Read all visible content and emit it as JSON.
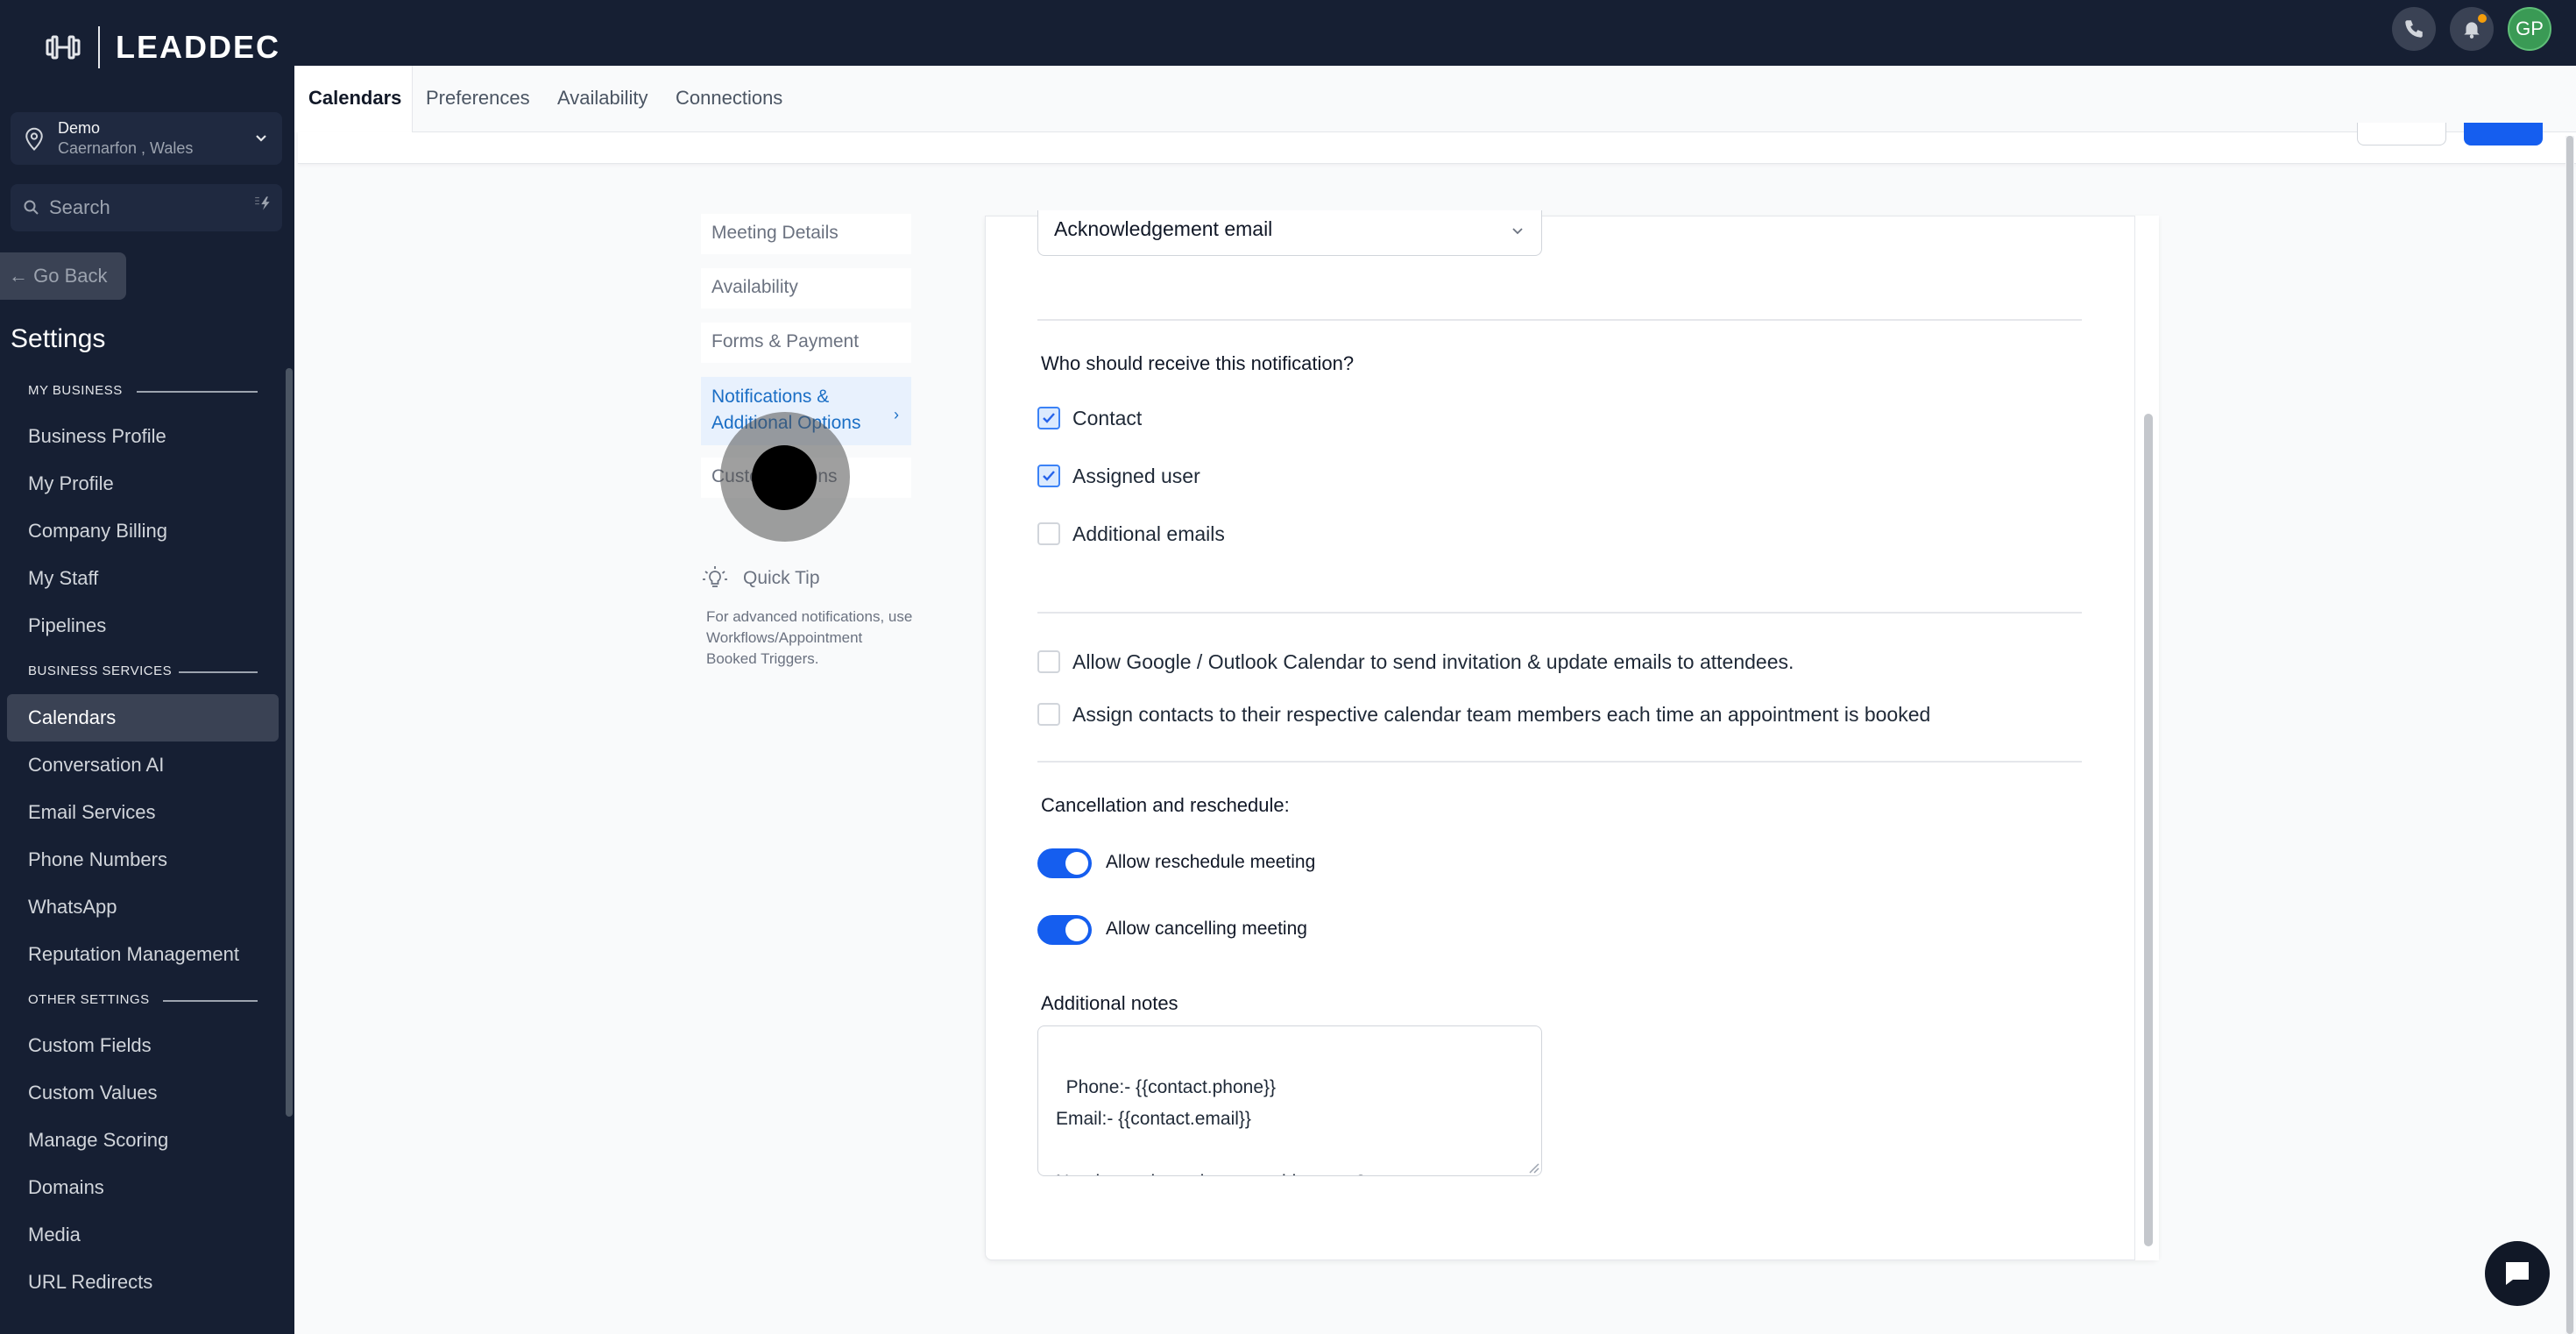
{
  "app": {
    "logo_text": "LEADDEC"
  },
  "location": {
    "name": "Demo",
    "sub": "Caernarfon , Wales"
  },
  "search": {
    "placeholder": "Search"
  },
  "sidebar": {
    "go_back": "Go Back",
    "settings_title": "Settings",
    "sections": {
      "my_business": "MY BUSINESS",
      "business_services": "BUSINESS SERVICES",
      "other_settings": "OTHER SETTINGS"
    },
    "items": [
      "Business Profile",
      "My Profile",
      "Company Billing",
      "My Staff",
      "Pipelines",
      "Calendars",
      "Conversation AI",
      "Email Services",
      "Phone Numbers",
      "WhatsApp",
      "Reputation Management",
      "Custom Fields",
      "Custom Values",
      "Manage Scoring",
      "Domains",
      "Media",
      "URL Redirects"
    ],
    "active_item": "Calendars"
  },
  "top": {
    "avatar_initials": "GP"
  },
  "tabs": [
    "Calendars",
    "Preferences",
    "Availability",
    "Connections"
  ],
  "steps": {
    "meeting_details": "Meeting Details",
    "availability": "Availability",
    "forms_payment": "Forms & Payment",
    "notifications_line1": "Notifications &",
    "notifications_line2": "Additional Options",
    "customizations": "Customizations"
  },
  "quick_tip": {
    "title": "Quick Tip",
    "text": "For advanced notifications, use Workflows/Appointment Booked Triggers."
  },
  "form": {
    "email_select": "Acknowledgement email",
    "recipients_label": "Who should receive this notification?",
    "recipients": [
      {
        "label": "Contact",
        "checked": true
      },
      {
        "label": "Assigned user",
        "checked": true
      },
      {
        "label": "Additional emails",
        "checked": false
      }
    ],
    "options": [
      {
        "label": "Allow Google / Outlook Calendar to send invitation & update emails to attendees.",
        "checked": false
      },
      {
        "label": "Assign contacts to their respective calendar team members each time an appointment is booked",
        "checked": false
      }
    ],
    "cancel_label": "Cancellation and reschedule:",
    "toggles": [
      {
        "label": "Allow reschedule meeting",
        "on": true
      },
      {
        "label": "Allow cancelling meeting",
        "on": true
      }
    ],
    "notes_label": "Additional notes",
    "notes_text": "Phone:- {{contact.phone}}\nEmail:- {{contact.email}}\n\nNeed to make a change to this event?\nReschedule:"
  },
  "colors": {
    "accent": "#155eef",
    "sidebar_bg": "#161f33",
    "active_step_text": "#1a6ec5"
  }
}
